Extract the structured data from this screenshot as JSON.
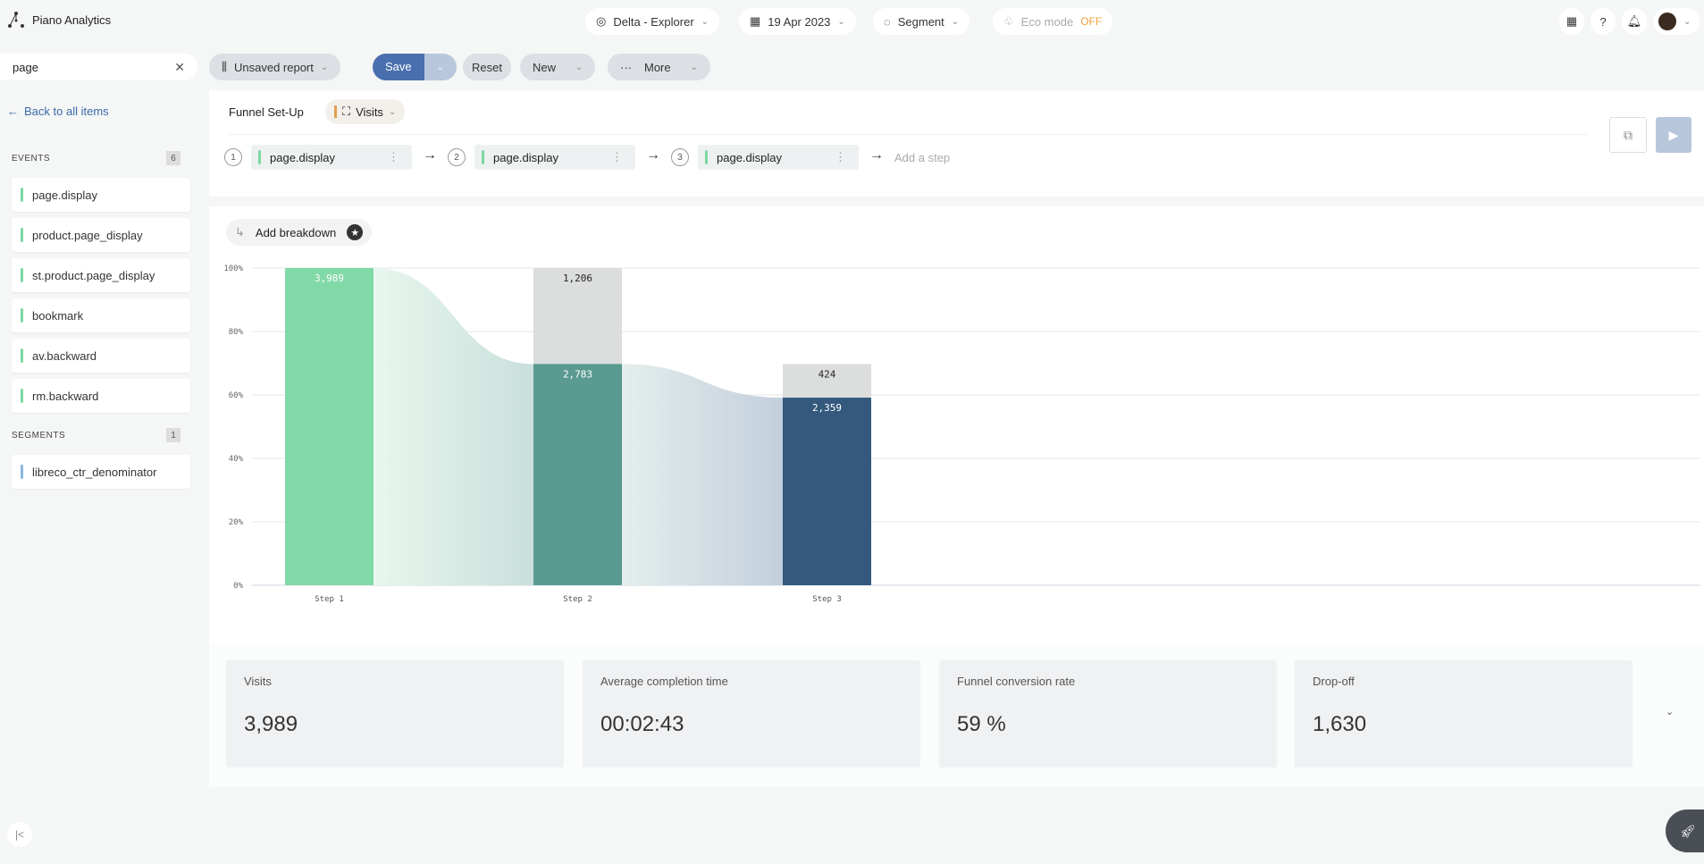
{
  "app": {
    "name": "Piano Analytics"
  },
  "topbar": {
    "site": "Delta - Explorer",
    "date": "19 Apr 2023",
    "segment": "Segment",
    "eco_label": "Eco mode",
    "eco_state": "OFF"
  },
  "search": {
    "value": "page"
  },
  "toolbar": {
    "report": "Unsaved report",
    "save": "Save",
    "reset": "Reset",
    "new": "New",
    "more": "More"
  },
  "sidebar": {
    "back": "Back to all items",
    "events_label": "EVENTS",
    "events_count": "6",
    "events": [
      "page.display",
      "product.page_display",
      "st.product.page_display",
      "bookmark",
      "av.backward",
      "rm.backward"
    ],
    "segments_label": "SEGMENTS",
    "segments_count": "1",
    "segments": [
      "libreco_ctr_denominator"
    ]
  },
  "funnel": {
    "title": "Funnel Set-Up",
    "metric": "Visits",
    "steps": [
      {
        "num": "1",
        "label": "page.display"
      },
      {
        "num": "2",
        "label": "page.display"
      },
      {
        "num": "3",
        "label": "page.display"
      }
    ],
    "add_step": "Add a step",
    "add_breakdown": "Add breakdown"
  },
  "chart_data": {
    "type": "bar",
    "categories": [
      "Step 1",
      "Step 2",
      "Step 3"
    ],
    "series": [
      {
        "values": [
          3989,
          2783,
          2359
        ],
        "colors": [
          "#82d9a8",
          "#5b9a91",
          "#34597d"
        ]
      },
      {
        "values": [
          0,
          1206,
          424
        ],
        "color": "#dcdddd"
      }
    ],
    "value_labels": [
      [
        "3,989",
        "2,783",
        "2,359"
      ],
      [
        "",
        "1,206",
        "424"
      ]
    ],
    "ylim": [
      0,
      100
    ],
    "yticks": [
      "0%",
      "20%",
      "40%",
      "60%",
      "80%",
      "100%"
    ],
    "grid": true
  },
  "kpis": [
    {
      "title": "Visits",
      "value": "3,989"
    },
    {
      "title": "Average completion time",
      "value": "00:02:43"
    },
    {
      "title": "Funnel conversion rate",
      "value": "59 %"
    },
    {
      "title": "Drop-off",
      "value": "1,630"
    }
  ]
}
